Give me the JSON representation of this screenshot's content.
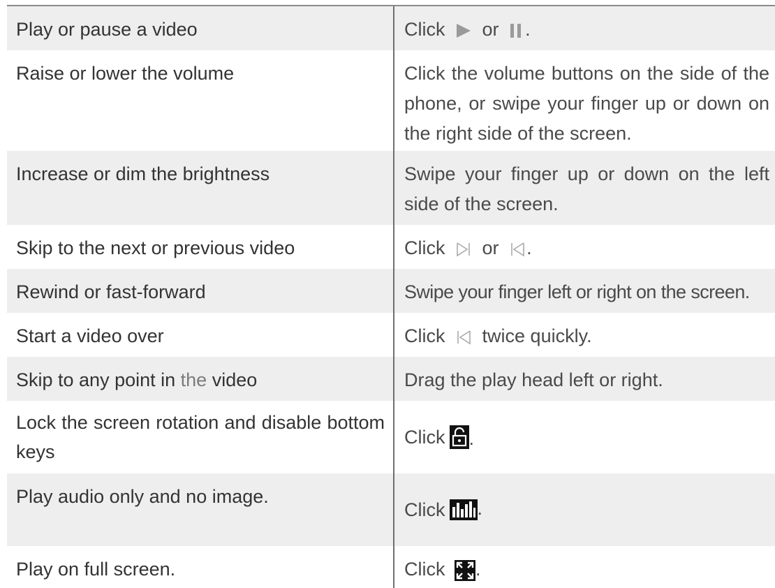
{
  "rows": [
    {
      "action": "Play or pause a video",
      "instr_pre": "Click",
      "instr_mid": "or",
      "instr_post": "."
    },
    {
      "action": "Raise or lower the volume",
      "instruction": "Click the volume buttons on the side of the phone, or swipe your finger up or down on the right side of the screen."
    },
    {
      "action": "Increase or dim the brightness",
      "instruction": "Swipe your finger up or down on the left side of the screen."
    },
    {
      "action": "Skip to the next or previous video",
      "instr_pre": "Click",
      "instr_mid": "or",
      "instr_post": "."
    },
    {
      "action": "Rewind or fast-forward",
      "instruction": "Swipe your finger left or right on the screen."
    },
    {
      "action": "Start a video over",
      "instr_pre": "Click",
      "instr_post": "twice quickly."
    },
    {
      "action_pre": "Skip to any point in ",
      "action_gray": "the",
      "action_post": " video",
      "instruction": "Drag the play head left or right."
    },
    {
      "action": "Lock the screen rotation and disable bottom keys",
      "instr_pre": "Click",
      "instr_post": "."
    },
    {
      "action": "Play audio only and no image.",
      "instr_pre": "Click",
      "instr_post": "."
    },
    {
      "action": "Play on full screen.",
      "instr_pre": "Click",
      "instr_post": "."
    }
  ],
  "icons": {
    "play": "play-icon",
    "pause": "pause-icon",
    "next": "skip-next-icon",
    "previous": "skip-previous-icon",
    "lock": "unlock-icon",
    "audio": "audio-only-icon",
    "fullscreen": "fullscreen-icon"
  },
  "colors": {
    "shaded_row": "#eeeeee",
    "icon_gray": "#9a9a9a",
    "divider": "#6f6f6f"
  }
}
